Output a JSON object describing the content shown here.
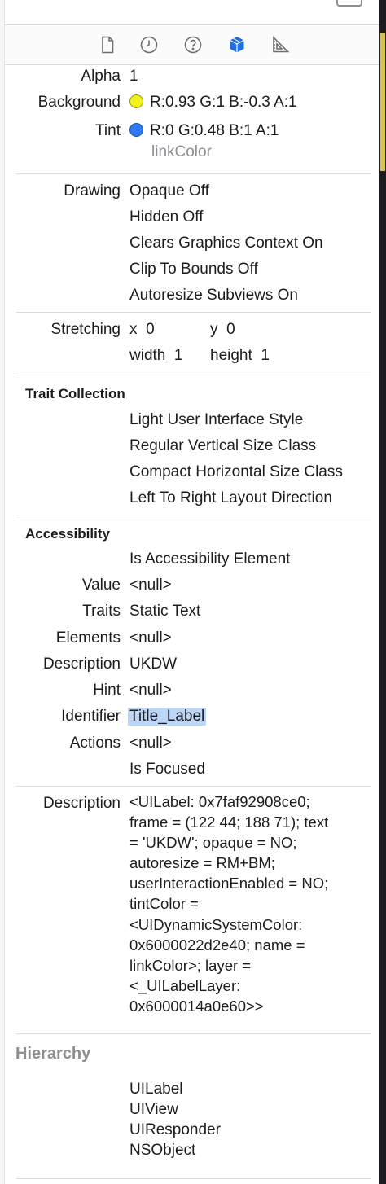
{
  "toolbar": {
    "icons": [
      "file-icon",
      "history-icon",
      "help-icon",
      "attributes-cube-icon",
      "size-ruler-icon"
    ]
  },
  "view": {
    "alpha_label": "Alpha",
    "alpha_value": "1",
    "background_label": "Background",
    "background_value": "R:0.93 G:1 B:-0.3 A:1",
    "background_color": "#f0f21a",
    "tint_label": "Tint",
    "tint_value": "R:0 G:0.48 B:1 A:1",
    "tint_color": "#2f7bf5",
    "tint_name": "linkColor"
  },
  "drawing": {
    "label": "Drawing",
    "items": [
      "Opaque Off",
      "Hidden Off",
      "Clears Graphics Context On",
      "Clip To Bounds Off",
      "Autoresize Subviews On"
    ]
  },
  "stretching": {
    "label": "Stretching",
    "x_label": "x",
    "x_value": "0",
    "y_label": "y",
    "y_value": "0",
    "width_label": "width",
    "width_value": "1",
    "height_label": "height",
    "height_value": "1"
  },
  "traits": {
    "title": "Trait Collection",
    "items": [
      "Light User Interface Style",
      "Regular Vertical Size Class",
      "Compact Horizontal Size Class",
      "Left To Right Layout Direction"
    ]
  },
  "accessibility": {
    "title": "Accessibility",
    "is_element": "Is Accessibility Element",
    "value_label": "Value",
    "value": "<null>",
    "traits_label": "Traits",
    "traits": "Static Text",
    "elements_label": "Elements",
    "elements": "<null>",
    "description_label": "Description",
    "description": "UKDW",
    "hint_label": "Hint",
    "hint": "<null>",
    "identifier_label": "Identifier",
    "identifier": "Title_Label",
    "actions_label": "Actions",
    "actions": "<null>",
    "is_focused": "Is Focused"
  },
  "description": {
    "label": "Description",
    "text": "<UILabel: 0x7faf92908ce0;\nframe = (122 44; 188 71); text\n= 'UKDW'; opaque = NO;\nautoresize = RM+BM;\nuserInteractionEnabled = NO;\ntintColor =\n<UIDynamicSystemColor:\n0x6000022d2e40; name =\nlinkColor>; layer =\n<_UILabelLayer:\n0x6000014a0e60>>"
  },
  "hierarchy": {
    "title": "Hierarchy",
    "items": [
      "UILabel",
      "UIView",
      "UIResponder",
      "NSObject"
    ]
  }
}
